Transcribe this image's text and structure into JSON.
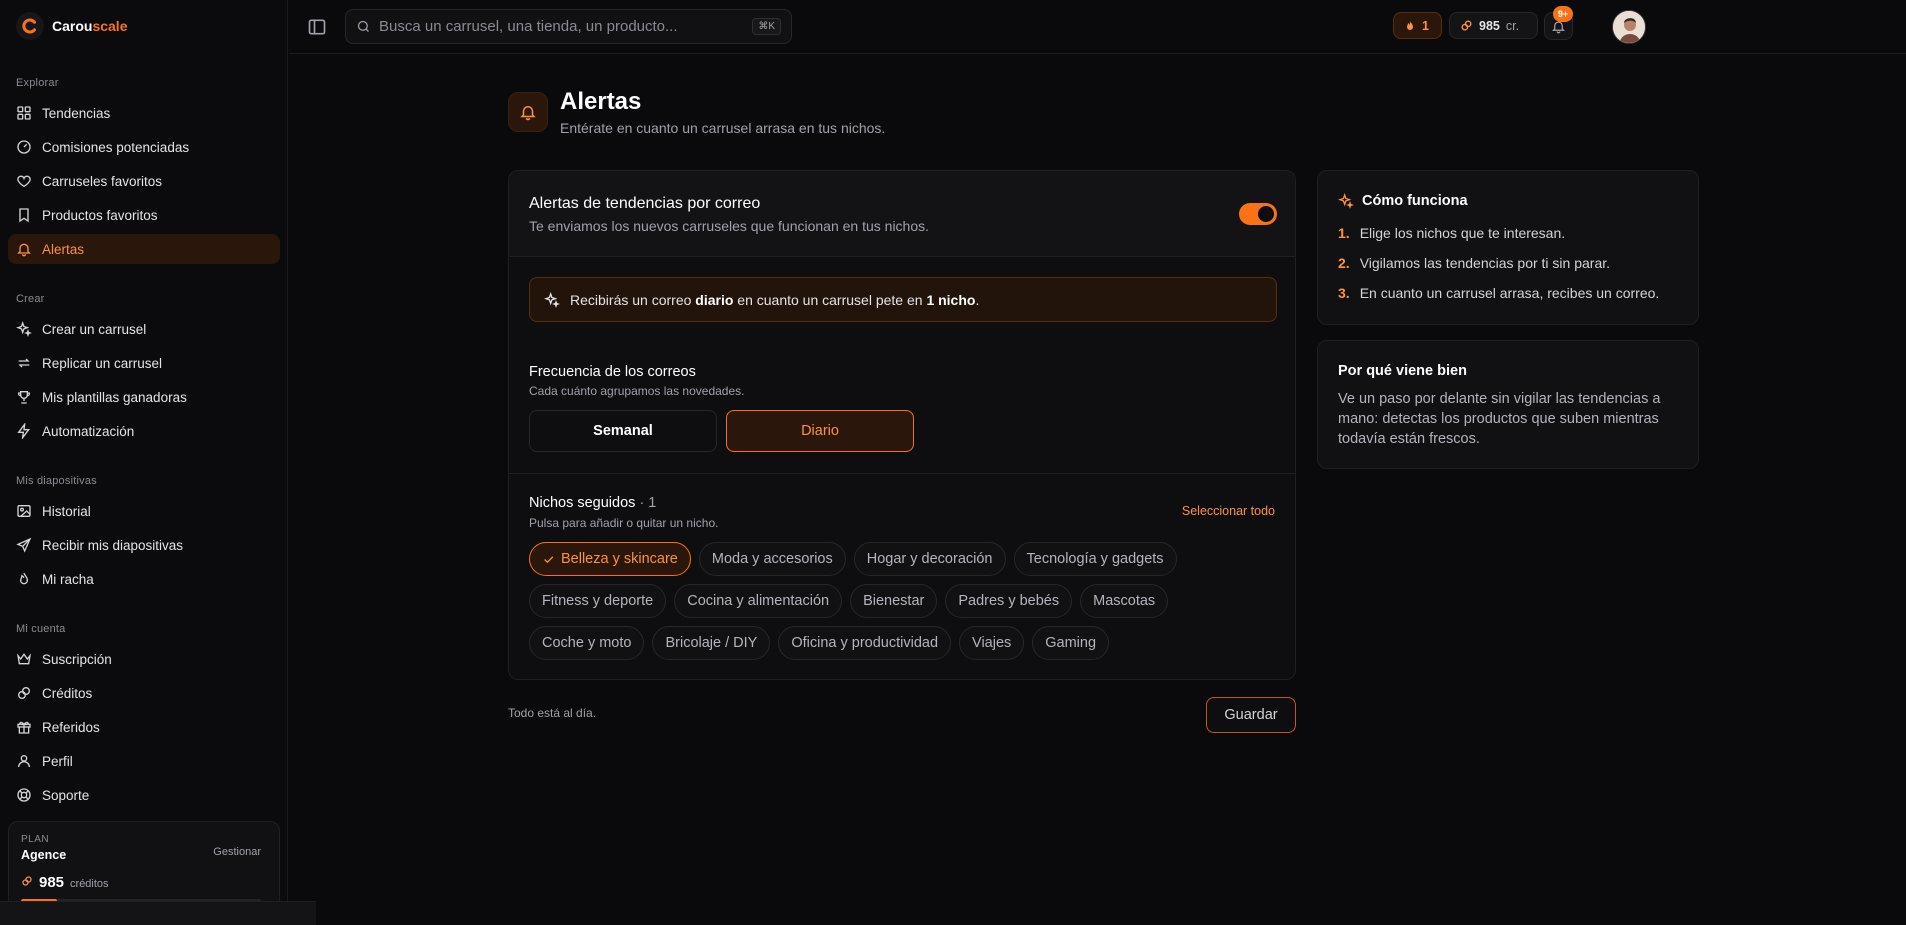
{
  "brand": {
    "name_part1": "Carou",
    "name_part2": "scale"
  },
  "search": {
    "placeholder": "Busca un carrusel, una tienda, un producto...",
    "shortcut": "⌘K"
  },
  "topbar": {
    "streak": "1",
    "credits": "985",
    "credits_unit": "cr.",
    "notifications_badge": "9+"
  },
  "sidebar": {
    "sections": [
      {
        "title": "Explorar",
        "items": [
          {
            "label": "Tendencias",
            "icon": "grid-icon"
          },
          {
            "label": "Comisiones potenciadas",
            "icon": "gauge-icon"
          },
          {
            "label": "Carruseles favoritos",
            "icon": "heart-icon"
          },
          {
            "label": "Productos favoritos",
            "icon": "bookmark-icon"
          },
          {
            "label": "Alertas",
            "icon": "bell-icon",
            "active": true
          }
        ]
      },
      {
        "title": "Crear",
        "items": [
          {
            "label": "Crear un carrusel",
            "icon": "sparkles-icon"
          },
          {
            "label": "Replicar un carrusel",
            "icon": "repeat-icon"
          },
          {
            "label": "Mis plantillas ganadoras",
            "icon": "trophy-icon"
          },
          {
            "label": "Automatización",
            "icon": "zap-icon"
          }
        ]
      },
      {
        "title": "Mis diapositivas",
        "items": [
          {
            "label": "Historial",
            "icon": "image-icon"
          },
          {
            "label": "Recibir mis diapositivas",
            "icon": "send-icon"
          },
          {
            "label": "Mi racha",
            "icon": "flame-icon"
          }
        ]
      },
      {
        "title": "Mi cuenta",
        "items": [
          {
            "label": "Suscripción",
            "icon": "crown-icon"
          },
          {
            "label": "Créditos",
            "icon": "coins-icon"
          },
          {
            "label": "Referidos",
            "icon": "gift-icon"
          },
          {
            "label": "Perfil",
            "icon": "user-icon"
          },
          {
            "label": "Soporte",
            "icon": "lifebuoy-icon"
          }
        ]
      }
    ],
    "plan": {
      "label": "PLAN",
      "name": "Agence",
      "manage": "Gestionar",
      "credits": "985",
      "credits_unit": "créditos",
      "credits_fraction": 0.15
    }
  },
  "page": {
    "title": "Alertas",
    "subtitle": "Entérate en cuanto un carrusel arrasa en tus nichos."
  },
  "alerts_card": {
    "title": "Alertas de tendencias por correo",
    "description": "Te enviamos los nuevos carruseles que funcionan en tus nichos.",
    "enabled": true,
    "notice": {
      "part1": "Recibirás un correo ",
      "bold1": "diario",
      "part2": " en cuanto un carrusel pete en ",
      "bold2": "1 nicho",
      "part3": "."
    },
    "frequency": {
      "title": "Frecuencia de los correos",
      "description": "Cada cuánto agrupamos las novedades.",
      "weekly": "Semanal",
      "daily": "Diario",
      "selected": "daily"
    },
    "niches": {
      "title": "Nichos seguidos",
      "count": "· 1",
      "description": "Pulsa para añadir o quitar un nicho.",
      "select_all": "Seleccionar todo",
      "items": [
        {
          "label": "Belleza y skincare",
          "selected": true
        },
        {
          "label": "Moda y accesorios",
          "selected": false
        },
        {
          "label": "Hogar y decoración",
          "selected": false
        },
        {
          "label": "Tecnología y gadgets",
          "selected": false
        },
        {
          "label": "Fitness y deporte",
          "selected": false
        },
        {
          "label": "Cocina y alimentación",
          "selected": false
        },
        {
          "label": "Bienestar",
          "selected": false
        },
        {
          "label": "Padres y bebés",
          "selected": false
        },
        {
          "label": "Mascotas",
          "selected": false
        },
        {
          "label": "Coche y moto",
          "selected": false
        },
        {
          "label": "Bricolaje / DIY",
          "selected": false
        },
        {
          "label": "Oficina y productividad",
          "selected": false
        },
        {
          "label": "Viajes",
          "selected": false
        },
        {
          "label": "Gaming",
          "selected": false
        }
      ]
    }
  },
  "footer": {
    "status": "Todo está al día.",
    "save": "Guardar"
  },
  "how_card": {
    "title": "Cómo funciona",
    "steps": [
      {
        "n": "1.",
        "text": "Elige los nichos que te interesan."
      },
      {
        "n": "2.",
        "text": "Vigilamos las tendencias por ti sin parar."
      },
      {
        "n": "3.",
        "text": "En cuanto un carrusel arrasa, recibes un correo."
      }
    ]
  },
  "why_card": {
    "title": "Por qué viene bien",
    "text": "Ve un paso por delante sin vigilar las tendencias a mano: detectas los productos que suben mientras todavía están frescos."
  },
  "colors": {
    "accent": "#f97316",
    "background": "#0a0a0c",
    "card": "#0e0e11"
  }
}
